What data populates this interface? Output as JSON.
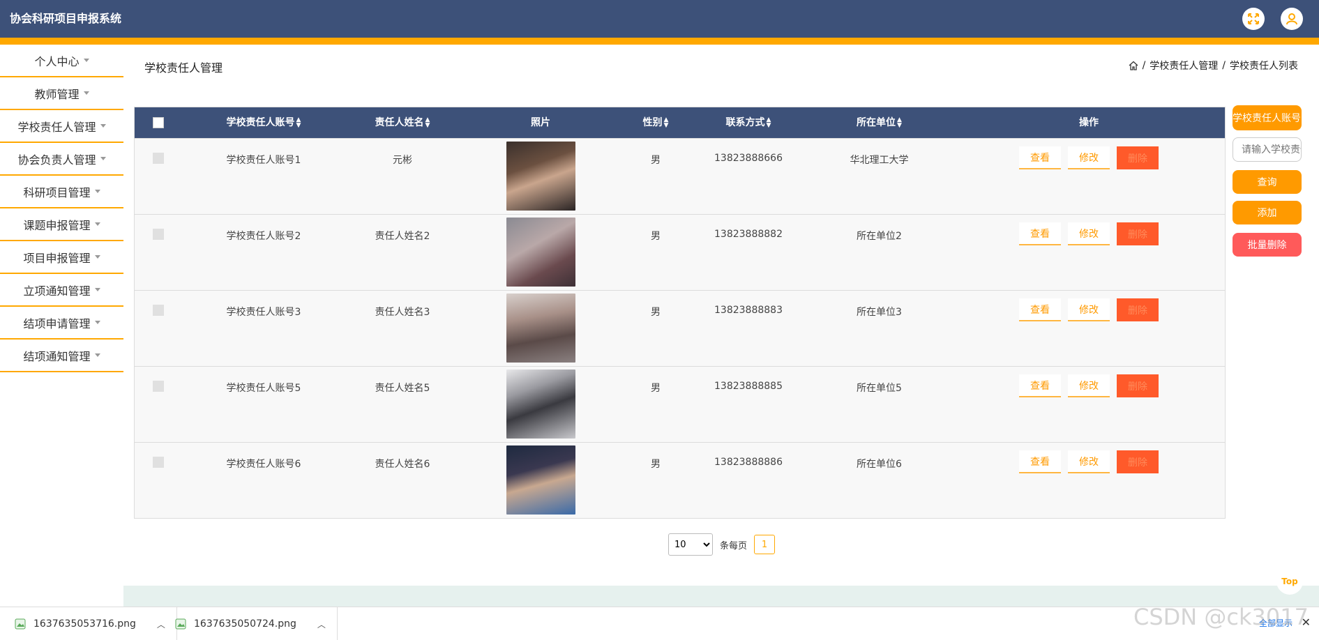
{
  "app": {
    "title": "协会科研项目申报系统"
  },
  "sidebar": {
    "items": [
      {
        "label": "个人中心"
      },
      {
        "label": "教师管理"
      },
      {
        "label": "学校责任人管理"
      },
      {
        "label": "协会负责人管理"
      },
      {
        "label": "科研项目管理"
      },
      {
        "label": "课题申报管理"
      },
      {
        "label": "项目申报管理"
      },
      {
        "label": "立项通知管理"
      },
      {
        "label": "结项申请管理"
      },
      {
        "label": "结项通知管理"
      }
    ]
  },
  "page": {
    "title": "学校责任人管理",
    "breadcrumb": {
      "level1": "学校责任人管理",
      "level2": "学校责任人列表",
      "sep": "/"
    }
  },
  "table": {
    "headers": {
      "account": "学校责任人账号",
      "name": "责任人姓名",
      "photo": "照片",
      "sex": "性别",
      "phone": "联系方式",
      "unit": "所在单位",
      "ops": "操作"
    },
    "rows": [
      {
        "account": "学校责任人账号1",
        "name": "元彬",
        "sex": "男",
        "phone": "13823888666",
        "unit": "华北理工大学"
      },
      {
        "account": "学校责任人账号2",
        "name": "责任人姓名2",
        "sex": "男",
        "phone": "13823888882",
        "unit": "所在单位2"
      },
      {
        "account": "学校责任人账号3",
        "name": "责任人姓名3",
        "sex": "男",
        "phone": "13823888883",
        "unit": "所在单位3"
      },
      {
        "account": "学校责任人账号5",
        "name": "责任人姓名5",
        "sex": "男",
        "phone": "13823888885",
        "unit": "所在单位5"
      },
      {
        "account": "学校责任人账号6",
        "name": "责任人姓名6",
        "sex": "男",
        "phone": "13823888886",
        "unit": "所在单位6"
      }
    ],
    "ops": {
      "view": "查看",
      "edit": "修改",
      "delete": "删除"
    }
  },
  "search": {
    "label": "学校责任人账号",
    "placeholder": "请输入学校责任人账号",
    "query": "查询",
    "add": "添加",
    "batch_delete": "批量删除"
  },
  "pager": {
    "page_size": "10",
    "per_page_label": "条每页",
    "current": "1"
  },
  "top_button": "Top",
  "downloads": [
    {
      "file": "1637635053716.png"
    },
    {
      "file": "1637635050724.png"
    }
  ],
  "download_bar": {
    "show_all": "全部显示"
  },
  "watermark": "CSDN @ck3017",
  "colors": {
    "header": "#3d5179",
    "accent": "#ffa800",
    "button": "#ff9a00",
    "danger": "#ff5a5a"
  }
}
